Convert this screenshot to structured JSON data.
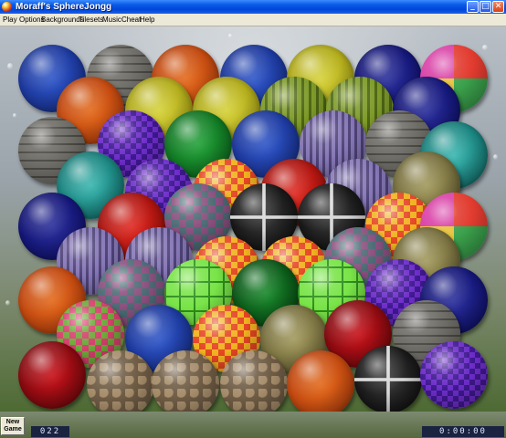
{
  "window": {
    "title": "Moraff's SphereJongg",
    "minimize_glyph": "_",
    "maximize_glyph": "□",
    "close_glyph": "✕"
  },
  "menu": {
    "items": [
      "Play",
      "Options",
      "Backgrounds",
      "Tilesets",
      "Music",
      "Cheat",
      "Help"
    ]
  },
  "status": {
    "new_game_line1": "New",
    "new_game_line2": "Game",
    "tiles_remaining": "022",
    "timer": "0:00:00"
  },
  "tile_styles": {
    "blue-scales": "radial-gradient(circle at 50% 50%, #2f56c8 0%, #1d3aa0 60%, #0d1e5c 100%)",
    "grey-stone": "repeating-linear-gradient(0deg, #6e6c66 0 7px, #4a4843 7px 9px), #5a5852",
    "orange-stone": "radial-gradient(circle at 50% 50%, #e36a1c 0%, #c44a10 60%, #6a2205 100%)",
    "navy-plain": "radial-gradient(circle at 50% 50%, #2b2f9a 0%, #15177a 60%, #07083c 100%)",
    "yellow-lace": "radial-gradient(circle at 50% 50%, #d6d23a 0%, #b3ad1c 60%, #5c580a 100%)",
    "patchwork": "conic-gradient(#e23b2f 0 25%, #3aa04b 25% 50%, #e8c23a 50% 75%, #d93fa6 75% 100%)",
    "green-stripe": "repeating-linear-gradient(90deg, #7f9b2a 0 5px, #4d6614 5px 8px)",
    "purple-check": "repeating-conic-gradient(#6d2dc9 0 25%, #3f1890 0 50%) 0 0 / 12px 12px",
    "green-marble": "radial-gradient(circle at 50% 50%, #24a23a 0%, #117a24 60%, #053d10 100%)",
    "purple-stripe": "repeating-linear-gradient(90deg, #8677b5 0 4px, #4e4378 4px 7px)",
    "teal-swirl": "radial-gradient(circle at 50% 50%, #3bb6b0 0%, #1b8580 60%, #0a3f3c 100%)",
    "olive-stone": "radial-gradient(circle at 50% 50%, #a39a5e 0%, #7a7240 60%, #3c3818 100%)",
    "red-diamond": "repeating-conic-gradient(#e64524 0 25%, #f0b21f 0 50%) 0 0 / 14px 14px",
    "red-scales": "radial-gradient(circle at 50% 50%, #e02b22 0%, #b0140f 60%, #560806 100%)",
    "brick-tiles": "repeating-conic-gradient(#8a4f7e 0 25%, #4c6a74 0 50%) 0 0 / 16px 16px",
    "black-steel": "linear-gradient(90deg, transparent 47%, #d8d8d8 48% 52%, transparent 53%), linear-gradient(0deg, transparent 47%, #d8d8d8 48% 52%, transparent 53%), radial-gradient(circle at 50% 50%, #3a3a3a 0%, #151515 70%)",
    "grid-green": "repeating-linear-gradient(0deg, #2e8f1d 0 2px, transparent 2px 16px), repeating-linear-gradient(90deg, #2e8f1d 0 2px, transparent 2px 16px), #79e448",
    "dark-green-marble": "radial-gradient(circle at 50% 50%, #1a8a2c 0%, #0b5a19 60%, #032b09 100%)",
    "multi-grid": "repeating-conic-gradient(#d63f6d 0 25%, #6ea83a 0 50%) 0 0 / 14px 14px",
    "cobblestone": "radial-gradient(circle at 30% 30%, #a58c6a 0 5px, transparent 6px) 0 0 / 14px 14px, #6e5b44",
    "dark-red": "radial-gradient(circle at 50% 50%, #c8121a 0%, #8d0a10 60%, #410306 100%)"
  },
  "board": {
    "spheres": [
      {
        "id": 1,
        "style": "blue-scales"
      },
      {
        "id": 2,
        "style": "grey-stone"
      },
      {
        "id": 3,
        "style": "orange-stone"
      },
      {
        "id": 4,
        "style": "blue-scales"
      },
      {
        "id": 5,
        "style": "yellow-lace"
      },
      {
        "id": 6,
        "style": "navy-plain"
      },
      {
        "id": 7,
        "style": "patchwork"
      },
      {
        "id": 8,
        "style": "orange-stone"
      },
      {
        "id": 9,
        "style": "yellow-lace"
      },
      {
        "id": 10,
        "style": "yellow-lace"
      },
      {
        "id": 11,
        "style": "green-stripe"
      },
      {
        "id": 12,
        "style": "green-stripe"
      },
      {
        "id": 13,
        "style": "navy-plain"
      },
      {
        "id": 14,
        "style": "grey-stone"
      },
      {
        "id": 15,
        "style": "purple-check"
      },
      {
        "id": 16,
        "style": "green-marble"
      },
      {
        "id": 17,
        "style": "blue-scales"
      },
      {
        "id": 18,
        "style": "purple-stripe"
      },
      {
        "id": 19,
        "style": "grey-stone"
      },
      {
        "id": 20,
        "style": "teal-swirl"
      },
      {
        "id": 21,
        "style": "teal-swirl"
      },
      {
        "id": 22,
        "style": "purple-check"
      },
      {
        "id": 23,
        "style": "red-diamond"
      },
      {
        "id": 24,
        "style": "red-scales"
      },
      {
        "id": 25,
        "style": "purple-stripe"
      },
      {
        "id": 26,
        "style": "olive-stone"
      },
      {
        "id": 27,
        "style": "navy-plain"
      },
      {
        "id": 28,
        "style": "red-scales"
      },
      {
        "id": 29,
        "style": "brick-tiles"
      },
      {
        "id": 30,
        "style": "black-steel"
      },
      {
        "id": 31,
        "style": "black-steel"
      },
      {
        "id": 32,
        "style": "red-diamond"
      },
      {
        "id": 33,
        "style": "patchwork"
      },
      {
        "id": 34,
        "style": "purple-stripe"
      },
      {
        "id": 35,
        "style": "purple-stripe"
      },
      {
        "id": 36,
        "style": "red-diamond"
      },
      {
        "id": 37,
        "style": "red-diamond"
      },
      {
        "id": 38,
        "style": "brick-tiles"
      },
      {
        "id": 39,
        "style": "olive-stone"
      },
      {
        "id": 40,
        "style": "orange-stone"
      },
      {
        "id": 41,
        "style": "brick-tiles"
      },
      {
        "id": 42,
        "style": "grid-green"
      },
      {
        "id": 43,
        "style": "dark-green-marble"
      },
      {
        "id": 44,
        "style": "grid-green"
      },
      {
        "id": 45,
        "style": "purple-check"
      },
      {
        "id": 46,
        "style": "navy-plain"
      },
      {
        "id": 47,
        "style": "multi-grid"
      },
      {
        "id": 48,
        "style": "blue-scales"
      },
      {
        "id": 49,
        "style": "red-diamond"
      },
      {
        "id": 50,
        "style": "olive-stone"
      },
      {
        "id": 51,
        "style": "dark-red"
      },
      {
        "id": 52,
        "style": "grey-stone"
      },
      {
        "id": 53,
        "style": "dark-red"
      },
      {
        "id": 54,
        "style": "cobblestone"
      },
      {
        "id": 55,
        "style": "cobblestone"
      },
      {
        "id": 56,
        "style": "cobblestone"
      },
      {
        "id": 57,
        "style": "orange-stone"
      },
      {
        "id": 58,
        "style": "black-steel"
      },
      {
        "id": 59,
        "style": "purple-check"
      }
    ]
  }
}
